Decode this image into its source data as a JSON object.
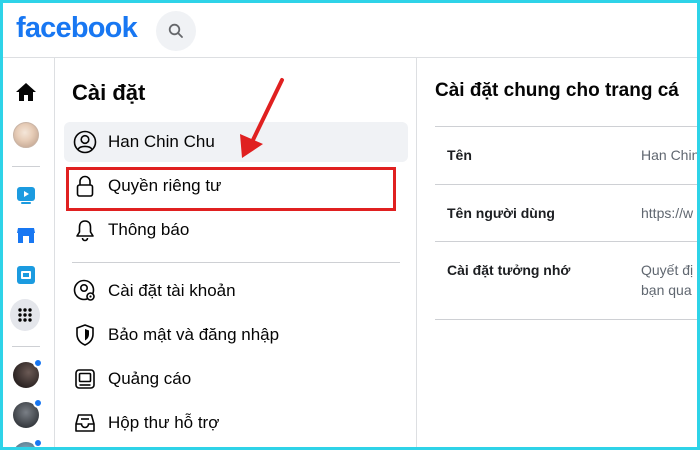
{
  "header": {
    "logo_text": "facebook",
    "search_icon": "search-icon"
  },
  "rail": {
    "items": [
      {
        "icon": "home-icon"
      },
      {
        "icon": "profile-avatar"
      },
      {
        "icon": "watch-icon"
      },
      {
        "icon": "marketplace-icon"
      },
      {
        "icon": "gaming-icon"
      },
      {
        "icon": "menu-grid-icon"
      },
      {
        "icon": "group-avatar",
        "badge": true
      },
      {
        "icon": "group-avatar",
        "badge": true
      },
      {
        "icon": "group-avatar",
        "badge": true
      }
    ]
  },
  "settings": {
    "title": "Cài đặt",
    "items": [
      {
        "label": "Han Chin Chu",
        "icon": "user-icon",
        "active": true
      },
      {
        "label": "Quyền riêng tư",
        "icon": "lock-icon",
        "highlighted": true
      },
      {
        "label": "Thông báo",
        "icon": "bell-icon"
      },
      {
        "label": "Cài đặt tài khoản",
        "icon": "account-settings-icon"
      },
      {
        "label": "Bảo mật và đăng nhập",
        "icon": "shield-icon"
      },
      {
        "label": "Quảng cáo",
        "icon": "ads-icon"
      },
      {
        "label": "Hộp thư hỗ trợ",
        "icon": "support-inbox-icon"
      }
    ]
  },
  "content": {
    "title": "Cài đặt chung cho trang cá",
    "rows": [
      {
        "label": "Tên",
        "value": "Han Chin"
      },
      {
        "label": "Tên người dùng",
        "value": "https://w"
      },
      {
        "label": "Cài đặt tưởng nhớ",
        "value_line1": "Quyết đị",
        "value_line2": "bạn qua"
      }
    ]
  },
  "colors": {
    "brand": "#1877f2",
    "highlight_box": "#e02020",
    "frame": "#2ed3e8"
  }
}
